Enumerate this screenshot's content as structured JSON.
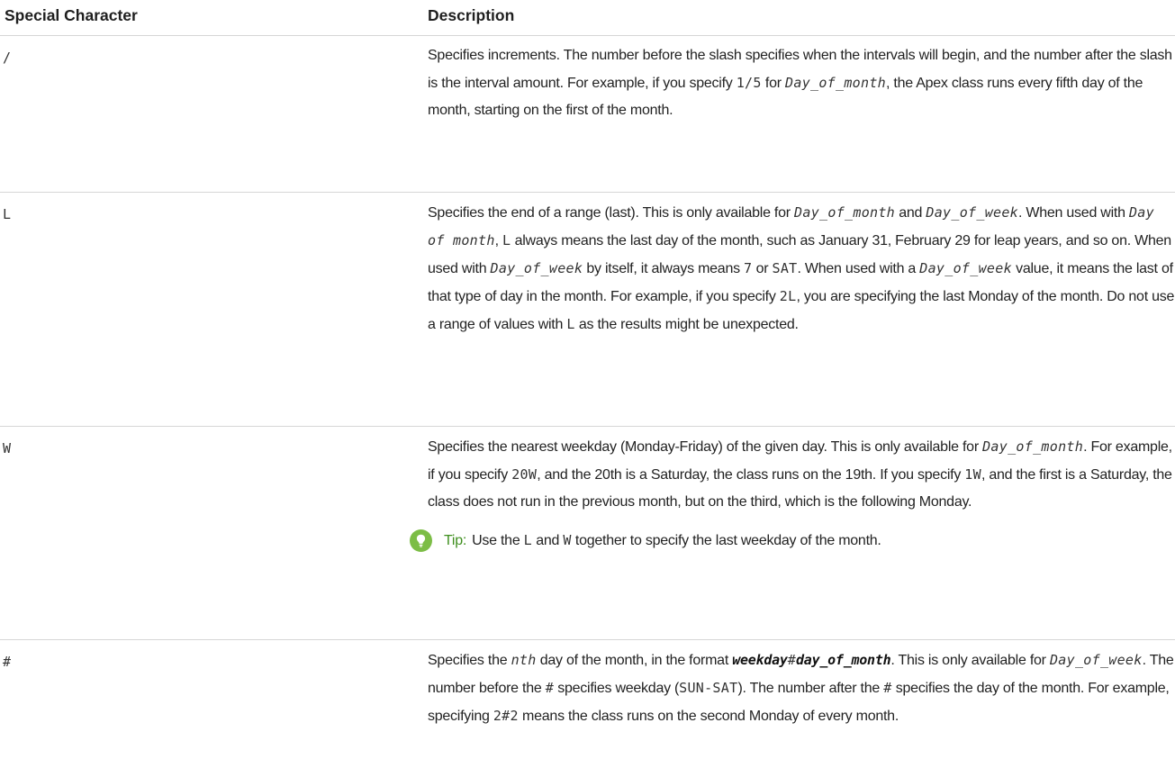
{
  "table": {
    "headers": {
      "char": "Special Character",
      "desc": "Description"
    },
    "rows": {
      "slash": {
        "char": "/",
        "d": {
          "t1": "Specifies increments. The number before the slash specifies when the intervals will begin, and the number after the slash is the interval amount. For example, if you specify ",
          "c1": "1/5",
          "t2": " for ",
          "c2": "Day_of_month",
          "t3": ", the Apex class runs every fifth day of the month, starting on the first of the month."
        }
      },
      "l": {
        "char": "L",
        "d": {
          "t1": "Specifies the end of a range (last). This is only available for ",
          "c1": "Day_of_month",
          "t2": " and ",
          "c2": "Day_of_week",
          "t3": ". When used with ",
          "c3": "Day of month",
          "t4": ", ",
          "c4": "L",
          "t5": " always means the last day of the month, such as January 31, February 29 for leap years, and so on. When used with ",
          "c5": "Day_of_week",
          "t6": " by itself, it always means ",
          "c6": "7",
          "t7": " or ",
          "c7": "SAT",
          "t8": ". When used with a ",
          "c8": "Day_of_week",
          "t9": " value, it means the last of that type of day in the month. For example, if you specify ",
          "c9": "2L",
          "t10": ", you are specifying the last Monday of the month. Do not use a range of values with ",
          "c10": "L",
          "t11": " as the results might be unexpected."
        }
      },
      "w": {
        "char": "W",
        "d": {
          "t1": "Specifies the nearest weekday (Monday-Friday) of the given day. This is only available for ",
          "c1": "Day_of_month",
          "t2": ". For example, if you specify ",
          "c2": "20W",
          "t3": ", and the 20th is a Saturday, the class runs on the 19th. If you specify ",
          "c3": "1W",
          "t4": ", and the first is a Saturday, the class does not run in the previous month, but on the third, which is the following Monday."
        },
        "tip": {
          "label": "Tip:",
          "t1": "Use the ",
          "c1": "L",
          "t2": " and ",
          "c2": "W",
          "t3": " together to specify the last weekday of the month."
        }
      },
      "hash": {
        "char": "#",
        "d": {
          "t1": "Specifies the ",
          "c1": "nth",
          "t2": " day of the month, in the format ",
          "b1": "weekday",
          "b2": "#",
          "b3": "day_of_month",
          "t3": ". This is only available for ",
          "c2": "Day_of_week",
          "t4": ". The number before the ",
          "c3": "#",
          "t5": " specifies weekday (",
          "c4": "SUN-SAT",
          "t6": "). The number after the ",
          "c5": "#",
          "t7": " specifies the day of the month. For example, specifying ",
          "c6": "2#2",
          "t8": " means the class runs on the second Monday of every month."
        }
      }
    }
  },
  "colors": {
    "tip_icon": "#7cbd46",
    "tip_label": "#3f8f1f",
    "divider": "#d6d6d6"
  },
  "icons": {
    "tip": "lightbulb-icon"
  }
}
